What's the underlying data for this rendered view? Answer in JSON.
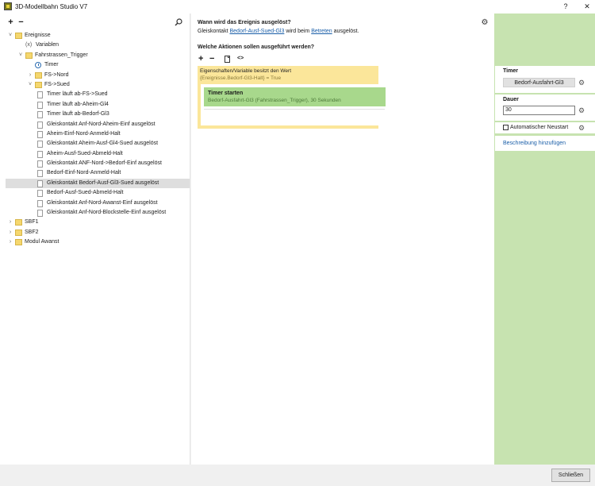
{
  "window": {
    "title": "3D-Modellbahn Studio V7",
    "help_label": "?",
    "close_label": "✕"
  },
  "tree_toolbar": {
    "add": "+",
    "remove": "−"
  },
  "tree": [
    {
      "label": "Ereignisse",
      "icon": "folder-icon",
      "depth": 0,
      "expander": "expanded"
    },
    {
      "label": "Variablen",
      "icon": "variable-icon",
      "depth": 1,
      "expander": "none",
      "icon_text": "(x)"
    },
    {
      "label": "Fahrstrassen_Trigger",
      "icon": "folder-icon",
      "depth": 1,
      "expander": "expanded"
    },
    {
      "label": "Timer",
      "icon": "clock-icon",
      "depth": 2,
      "expander": "none"
    },
    {
      "label": "FS->Nord",
      "icon": "folder-icon",
      "depth": 2,
      "expander": "collapsed"
    },
    {
      "label": "FS->Sued",
      "icon": "folder-icon",
      "depth": 2,
      "expander": "expanded"
    },
    {
      "label": "Timer läuft ab-FS->Sued",
      "icon": "document-icon",
      "depth": 3,
      "expander": "none"
    },
    {
      "label": "Timer läuft ab-Aheim-Gl4",
      "icon": "document-icon",
      "depth": 3,
      "expander": "none"
    },
    {
      "label": "Timer läuft ab-Bedorf-Gl3",
      "icon": "document-icon",
      "depth": 3,
      "expander": "none"
    },
    {
      "label": "Gleiskontakt Anf-Nord-Aheim-Einf ausgelöst",
      "icon": "document-icon",
      "depth": 3,
      "expander": "none"
    },
    {
      "label": "Aheim-Einf-Nord-Anmeld-Halt",
      "icon": "document-icon",
      "depth": 3,
      "expander": "none"
    },
    {
      "label": "Gleiskontakt Aheim-Ausf-Gl4-Sued ausgelöst",
      "icon": "document-icon",
      "depth": 3,
      "expander": "none"
    },
    {
      "label": "Aheim-Ausf-Sued-Abmeld-Halt",
      "icon": "document-icon",
      "depth": 3,
      "expander": "none"
    },
    {
      "label": "Gleiskontakt ANF-Nord->Bedorf-Einf ausgelöst",
      "icon": "document-icon",
      "depth": 3,
      "expander": "none"
    },
    {
      "label": "Bedorf-Einf-Nord-Anmeld-Halt",
      "icon": "document-icon",
      "depth": 3,
      "expander": "none"
    },
    {
      "label": "Gleiskontakt Bedorf-Ausf-Gl3-Sued ausgelöst",
      "icon": "document-icon",
      "depth": 3,
      "expander": "none",
      "selected": true
    },
    {
      "label": "Bedorf-Ausf-Sued-Abmeld-Halt",
      "icon": "document-icon",
      "depth": 3,
      "expander": "none"
    },
    {
      "label": "Gleiskontakt Anf-Nord-Awanst-Einf ausgelöst",
      "icon": "document-icon",
      "depth": 3,
      "expander": "none"
    },
    {
      "label": "Gleiskontakt Anf-Nord-Blockstelle-Einf ausgelöst",
      "icon": "document-icon",
      "depth": 3,
      "expander": "none"
    },
    {
      "label": "SBF1",
      "icon": "folder-icon",
      "depth": 0,
      "expander": "collapsed"
    },
    {
      "label": "SBF2",
      "icon": "folder-icon",
      "depth": 0,
      "expander": "collapsed"
    },
    {
      "label": "Modul Awanst",
      "icon": "folder-icon",
      "depth": 0,
      "expander": "collapsed"
    }
  ],
  "main": {
    "trigger_heading": "Wann wird das Ereignis ausgelöst?",
    "trigger_prefix": "Gleiskontakt",
    "trigger_contact": "Bedorf-Ausf-Sued-Gl3",
    "trigger_middle": "wird beim",
    "trigger_event": "Betreten",
    "trigger_suffix": "ausgelöst.",
    "actions_heading": "Welche Aktionen sollen ausgeführt werden?",
    "toolbar": {
      "add": "+",
      "remove": "−",
      "paste": "paste-icon",
      "code": "<>"
    },
    "condition": {
      "title": "Eigenschaften/Variable besitzt den Wert",
      "detail": "{Ereignisse.Bedorf-Gl3-Halt} = True"
    },
    "action": {
      "title": "Timer starten",
      "detail": "Bedorf-Ausfahrt-Gl3 (Fahrstrassen_Trigger), 30 Sekunden"
    }
  },
  "properties": {
    "timer_label": "Timer",
    "timer_value": "Bedorf-Ausfahrt-Gl3",
    "duration_label": "Dauer",
    "duration_value": "30",
    "auto_restart_label": "Automatischer Neustart",
    "auto_restart_checked": false,
    "description_link": "Beschreibung hinzufügen"
  },
  "footer": {
    "close_label": "Schließen"
  },
  "colors": {
    "condition": "#fbe69a",
    "action": "#a8d88c",
    "properties_bg": "#c7e3b0",
    "link": "#1a5ea8",
    "selection": "#dedede"
  }
}
